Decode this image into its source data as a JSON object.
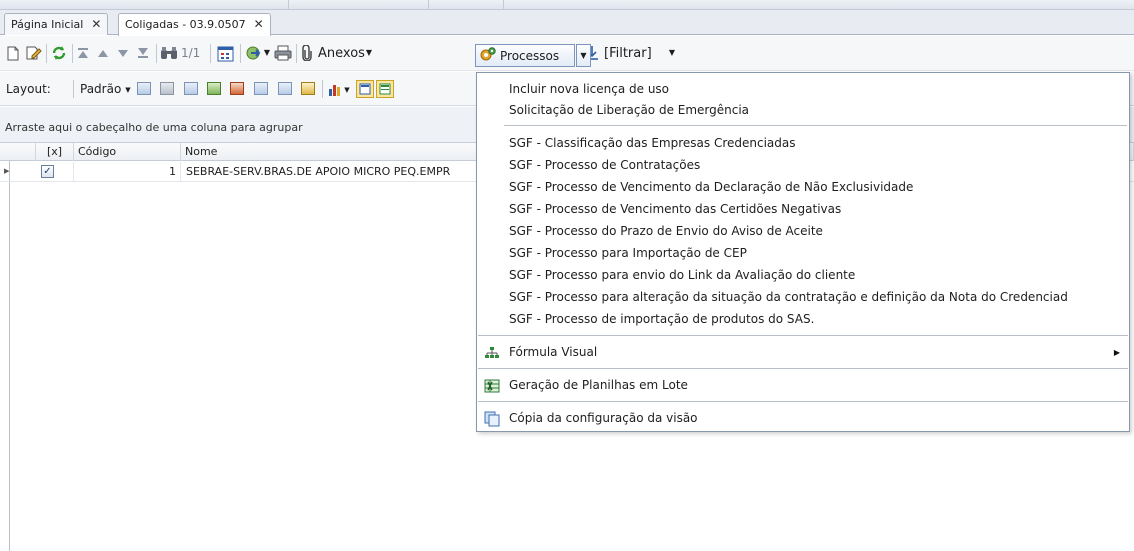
{
  "tabs": [
    {
      "label": "Página Inicial",
      "close": "✕"
    },
    {
      "label": "Coligadas - 03.9.0507",
      "close": "✕"
    }
  ],
  "toolbar": {
    "page_counter": "1/1",
    "anexos_label": "Anexos",
    "processos_label": "Processos",
    "filtrar_label": "[Filtrar]"
  },
  "layout_bar": {
    "layout_label": "Layout:",
    "layout_value": "Padrão"
  },
  "group_panel": {
    "hint": "Arraste aqui o cabeçalho de uma coluna para agrupar"
  },
  "grid": {
    "columns": [
      "[x]",
      "Código",
      "Nome"
    ],
    "rows": [
      {
        "checked": true,
        "codigo": "1",
        "nome": "SEBRAE-SERV.BRAS.DE APOIO MICRO PEQ.EMPR"
      }
    ]
  },
  "menu": {
    "items": [
      "Incluir nova licença de uso",
      "Solicitação de Liberação de Emergência",
      "SGF - Classificação das Empresas Credenciadas",
      "SGF - Processo de Contratações",
      "SGF - Processo de Vencimento da Declaração de Não Exclusividade",
      "SGF - Processo de Vencimento das Certidões Negativas",
      "SGF - Processo do Prazo de Envio do Aviso de Aceite",
      "SGF - Processo para Importação de CEP",
      "SGF - Processo para envio do Link da Avaliação do cliente",
      "SGF - Processo para alteração da situação da contratação e definição da Nota do Credenciad",
      "SGF - Processo de importação de produtos do SAS."
    ],
    "formula_visual": "Fórmula Visual",
    "geracao_planilhas": "Geração de Planilhas em Lote",
    "copia_configuracao": "Cópia da configuração da visão"
  },
  "colors": {
    "accent_border": "#7d96bb",
    "menu_border": "#8897ad",
    "refresh_green": "#2e9c2e"
  }
}
